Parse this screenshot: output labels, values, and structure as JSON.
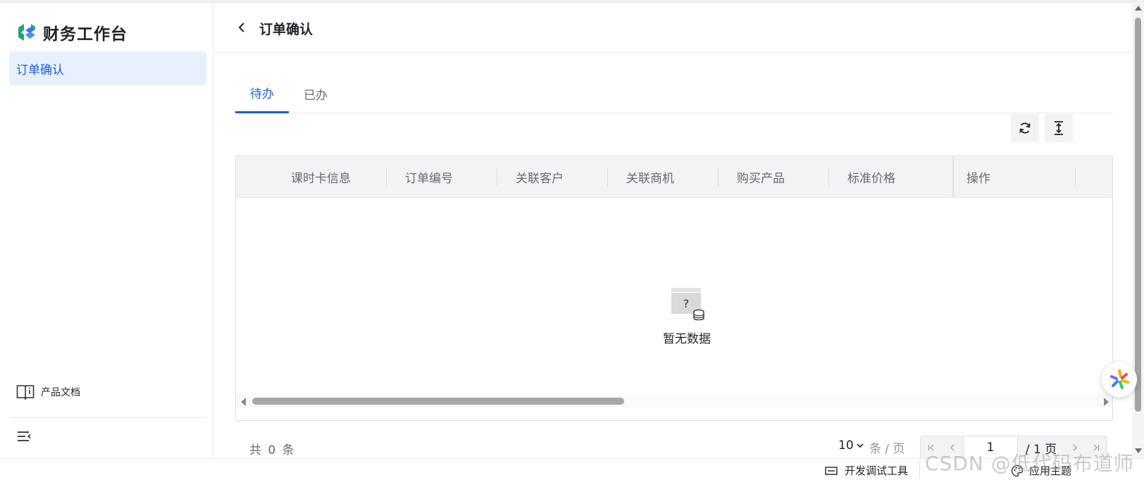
{
  "app": {
    "title": "财务工作台"
  },
  "sidebar": {
    "items": [
      {
        "label": "订单确认",
        "active": true
      }
    ],
    "docs_label": "产品文档"
  },
  "header": {
    "title": "订单确认"
  },
  "tabs": [
    {
      "label": "待办",
      "active": true
    },
    {
      "label": "已办",
      "active": false
    }
  ],
  "table": {
    "columns": [
      "课时卡信息",
      "订单编号",
      "关联客户",
      "关联商机",
      "购买产品",
      "标准价格",
      "操作"
    ],
    "rows": [],
    "empty_text": "暂无数据"
  },
  "pagination": {
    "total_text": "共 0 条",
    "page_size": "10",
    "page_size_unit": "条 / 页",
    "current_page": "1",
    "total_pages_text": "/ 1 页"
  },
  "devbar": {
    "dev_tools_label": "开发调试工具",
    "theme_label": "应用主题"
  },
  "watermark": "CSDN @低代码布道师",
  "colors": {
    "accent": "#1d5cd8",
    "active_bg": "#e8f0fe",
    "header_bg": "#f2f3f5"
  }
}
